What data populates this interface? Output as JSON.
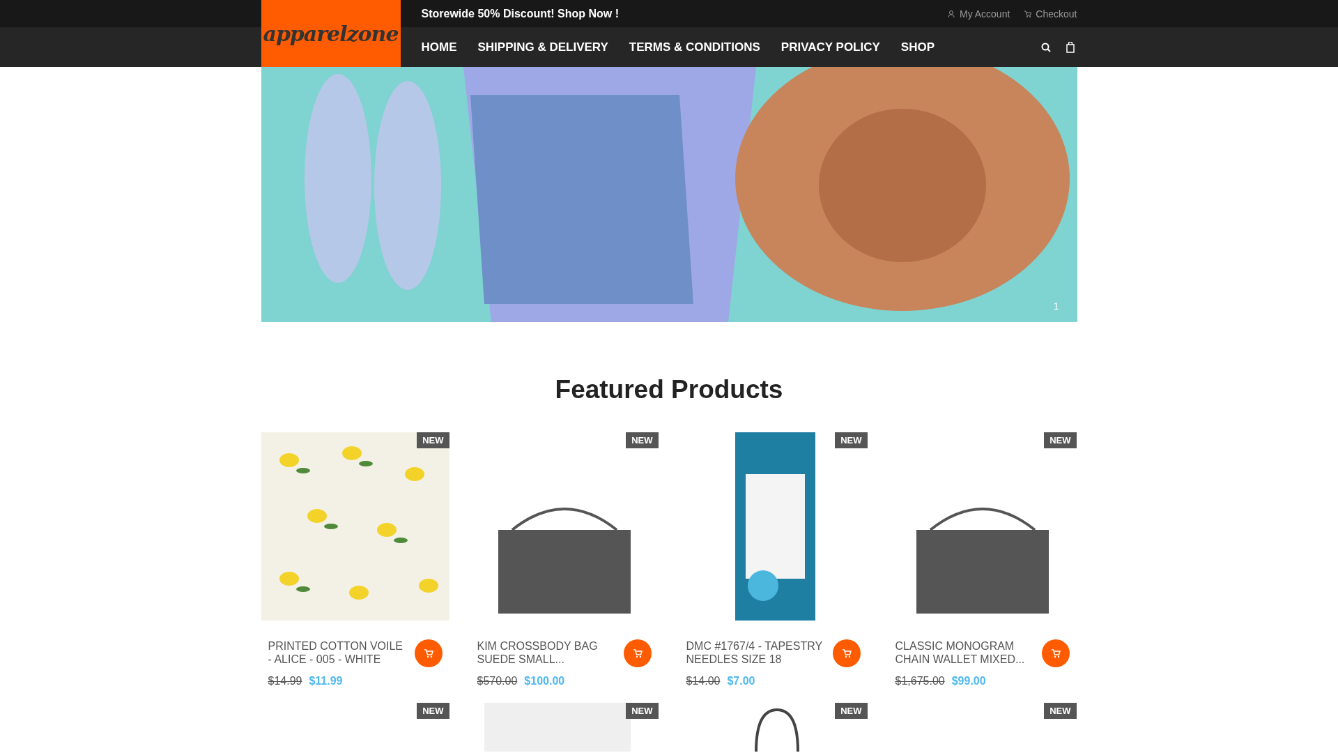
{
  "top_bar": {
    "promo": "Storewide 50% Discount! Shop Now !",
    "links": [
      {
        "label": "My Account",
        "kind": "account"
      },
      {
        "label": "Checkout",
        "kind": "checkout"
      }
    ]
  },
  "logo": {
    "text": "apparelzone"
  },
  "nav": {
    "items": [
      {
        "label": "HOME"
      },
      {
        "label": "SHIPPING & DELIVERY"
      },
      {
        "label": "TERMS & CONDITIONS"
      },
      {
        "label": "PRIVACY POLICY"
      },
      {
        "label": "SHOP"
      }
    ]
  },
  "slider": {
    "page": "1"
  },
  "featured": {
    "title": "Featured Products",
    "products": [
      {
        "badge": "NEW",
        "name": "PRINTED COTTON VOILE - ALICE - 005 - WHITE",
        "old_price": "$14.99",
        "price": "$11.99",
        "kind": "fabric"
      },
      {
        "badge": "NEW",
        "name": "KIM CROSSBODY BAG SUEDE SMALL...",
        "old_price": "$570.00",
        "price": "$100.00",
        "kind": "bag"
      },
      {
        "badge": "NEW",
        "name": "DMC #1767/4 - TAPESTRY NEEDLES SIZE 18",
        "old_price": "$14.00",
        "price": "$7.00",
        "kind": "needles"
      },
      {
        "badge": "NEW",
        "name": "CLASSIC MONOGRAM CHAIN WALLET MIXED...",
        "old_price": "$1,675.00",
        "price": "$99.00",
        "kind": "bag"
      },
      {
        "badge": "NEW",
        "kind": "blank"
      },
      {
        "badge": "NEW",
        "kind": "grey"
      },
      {
        "badge": "NEW",
        "kind": "handbag"
      },
      {
        "badge": "NEW",
        "kind": "blank"
      }
    ]
  }
}
